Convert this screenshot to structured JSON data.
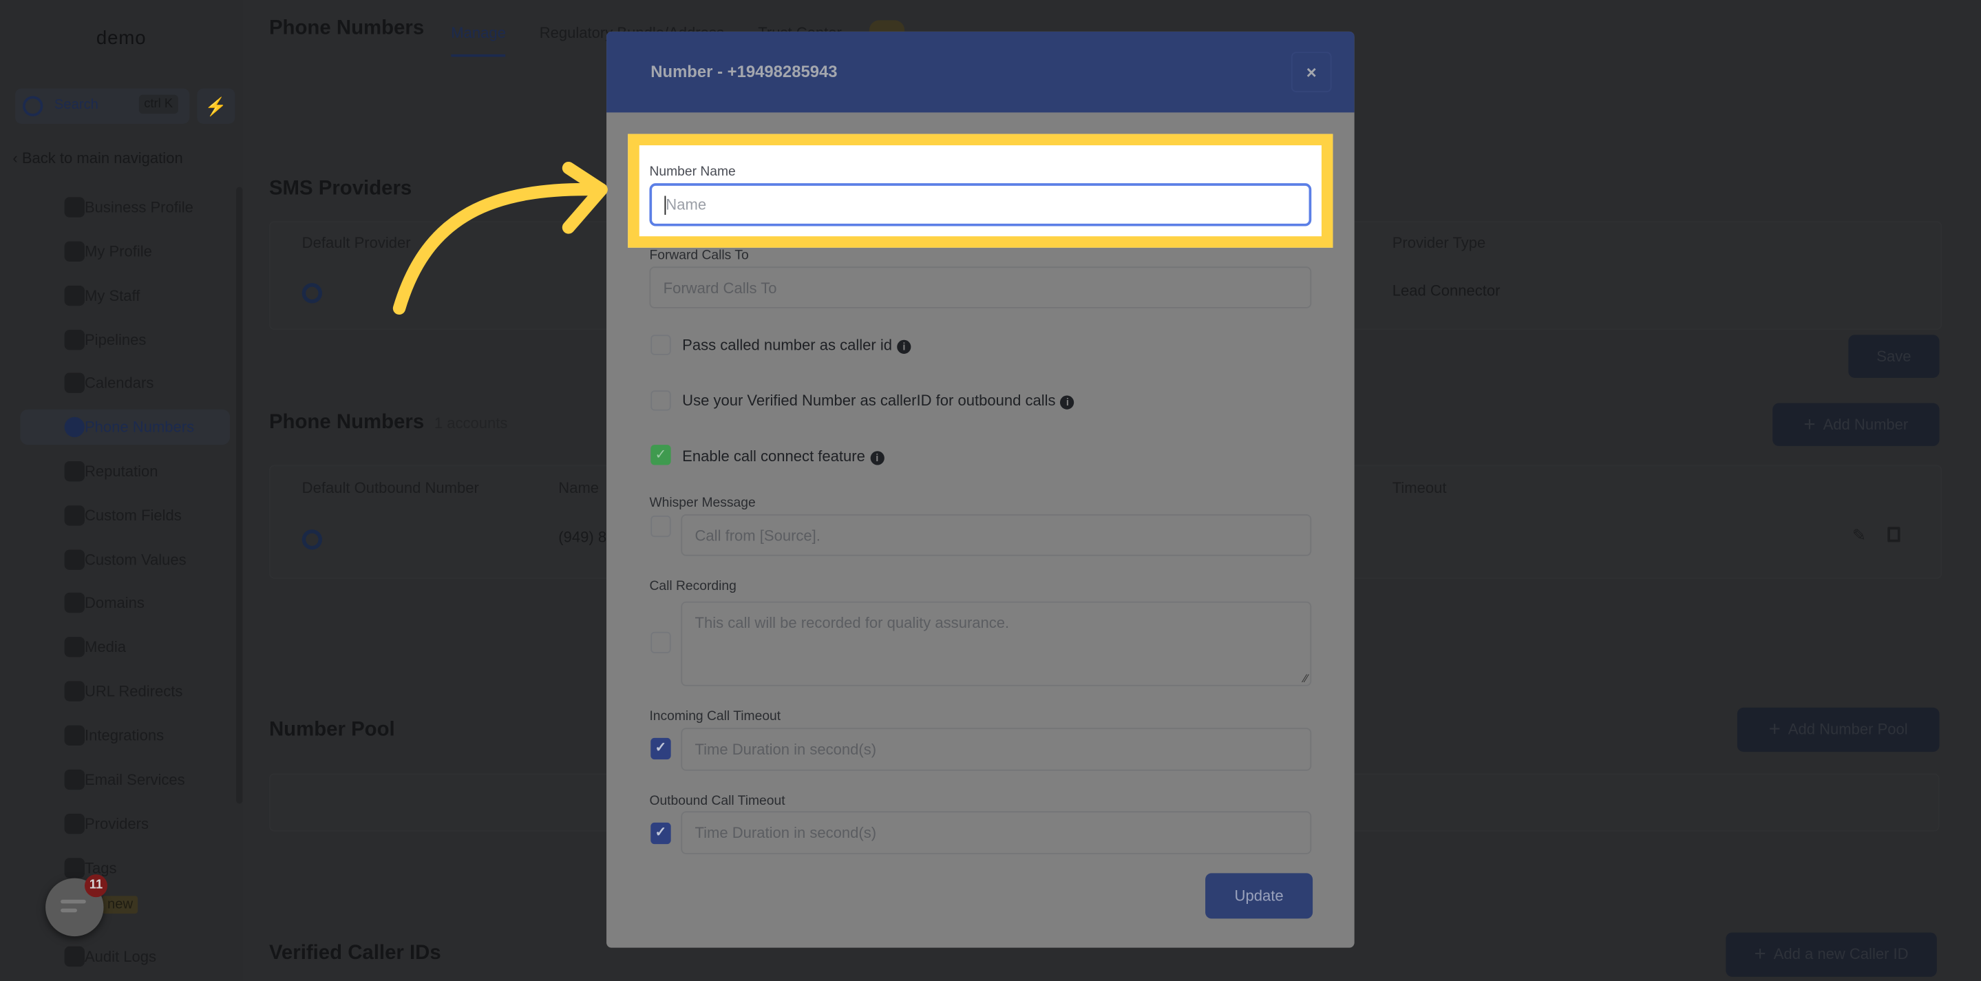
{
  "sidebar": {
    "logo": "demo",
    "search_label": "Search",
    "search_shortcut": "ctrl K",
    "back_label": "Back to main navigation",
    "items": [
      {
        "label": "Business Profile",
        "icon": "briefcase-icon"
      },
      {
        "label": "My Profile",
        "icon": "user-circle-icon"
      },
      {
        "label": "My Staff",
        "icon": "user-icon"
      },
      {
        "label": "Pipelines",
        "icon": "filter-icon"
      },
      {
        "label": "Calendars",
        "icon": "calendar-icon"
      },
      {
        "label": "Phone Numbers",
        "icon": "phone-icon",
        "active": true
      },
      {
        "label": "Reputation",
        "icon": "star-icon"
      },
      {
        "label": "Custom Fields",
        "icon": "fields-icon"
      },
      {
        "label": "Custom Values",
        "icon": "diamond-icon"
      },
      {
        "label": "Domains",
        "icon": "globe-icon"
      },
      {
        "label": "Media",
        "icon": "media-icon"
      },
      {
        "label": "URL Redirects",
        "icon": "redirect-icon"
      },
      {
        "label": "Integrations",
        "icon": "integrations-icon"
      },
      {
        "label": "Email Services",
        "icon": "email-icon"
      },
      {
        "label": "Providers",
        "icon": "clipboard-icon"
      },
      {
        "label": "Tags",
        "icon": "tag-icon"
      },
      {
        "label": "",
        "icon": "user-icon"
      },
      {
        "label": "Audit Logs",
        "icon": "chart-icon"
      }
    ],
    "new_badge": "new"
  },
  "header": {
    "title": "Phone Numbers",
    "tabs": [
      {
        "label": "Manage",
        "active": true
      },
      {
        "label": "Regulatory Bundle/Address"
      },
      {
        "label": "Trust Center"
      }
    ]
  },
  "sms_providers": {
    "title": "SMS Providers",
    "col_default": "Default Provider",
    "col_type": "Provider Type",
    "row_type": "Lead Connector",
    "save_label": "Save"
  },
  "phone_numbers": {
    "title": "Phone Numbers",
    "count": "1 accounts",
    "add_label": "Add Number",
    "col_default": "Default Outbound Number",
    "col_name": "Name",
    "col_timeout": "Timeout",
    "row_name": "(949) 8"
  },
  "number_pool": {
    "title": "Number Pool",
    "add_label": "Add Number Pool"
  },
  "verified_caller_ids": {
    "title": "Verified Caller IDs",
    "add_label": "Add a new Caller ID"
  },
  "chat_widget": {
    "badge": "11"
  },
  "modal": {
    "title": "Number - +19498285943",
    "close": "×",
    "number_name_label": "Number Name",
    "number_name_placeholder": "Name",
    "forward_label": "Forward Calls To",
    "forward_placeholder": "Forward Calls To",
    "pass_called": {
      "label": "Pass called number as caller id",
      "checked": false
    },
    "verified_caller": {
      "label": "Use your Verified Number as callerID for outbound calls",
      "checked": false
    },
    "call_connect": {
      "label": "Enable call connect feature",
      "checked": true
    },
    "whisper_label": "Whisper Message",
    "whisper_placeholder": "Call from [Source].",
    "whisper_checked": false,
    "recording_label": "Call Recording",
    "recording_placeholder": "This call will be recorded for quality assurance.",
    "recording_checked": false,
    "incoming_label": "Incoming Call Timeout",
    "incoming_placeholder": "Time Duration in second(s)",
    "incoming_checked": true,
    "outbound_label": "Outbound Call Timeout",
    "outbound_placeholder": "Time Duration in second(s)",
    "outbound_checked": true,
    "update_label": "Update",
    "info_glyph": "i",
    "check_glyph": "✓"
  },
  "colors": {
    "highlight": "#ffd244",
    "modal_header": "#2e3f72",
    "focus_border": "#5b7fe6",
    "checkbox_green": "#3f9a4f",
    "checkbox_blue": "#2e4080"
  }
}
